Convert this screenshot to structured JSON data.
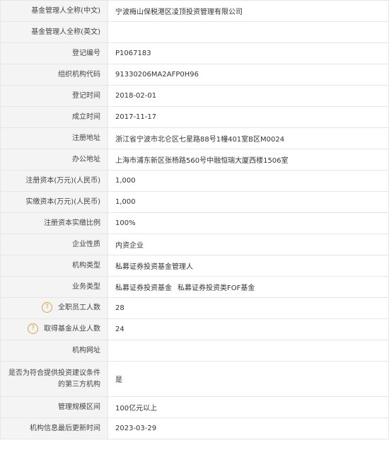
{
  "rows": [
    {
      "label": "基金管理人全称(中文)",
      "value": "宁波梅山保税港区凌顶投资管理有限公司"
    },
    {
      "label": "基金管理人全称(英文)",
      "value": ""
    },
    {
      "label": "登记编号",
      "value": "P1067183"
    },
    {
      "label": "组织机构代码",
      "value": "91330206MA2AFP0H96"
    },
    {
      "label": "登记时间",
      "value": "2018-02-01"
    },
    {
      "label": "成立时间",
      "value": "2017-11-17"
    },
    {
      "label": "注册地址",
      "value": "浙江省宁波市北仑区七星路88号1幢401室B区M0024"
    },
    {
      "label": "办公地址",
      "value": "上海市浦东新区张杨路560号中融恒瑞大厦西楼1506室"
    },
    {
      "label": "注册资本(万元)(人民币)",
      "value": "1,000"
    },
    {
      "label": "实缴资本(万元)(人民币)",
      "value": "1,000"
    },
    {
      "label": "注册资本实缴比例",
      "value": "100%"
    },
    {
      "label": "企业性质",
      "value": "内资企业"
    },
    {
      "label": "机构类型",
      "value": "私募证券投资基金管理人"
    },
    {
      "label": "业务类型",
      "value_1": "私募证券投资基金",
      "value_2": "私募证券投资类FOF基金"
    },
    {
      "label": "全职员工人数",
      "value": "28",
      "icon": "help-icon"
    },
    {
      "label": "取得基金从业人数",
      "value": "24",
      "icon": "help-icon"
    },
    {
      "label": "机构网址",
      "value": ""
    },
    {
      "label_line1": "是否为符合提供投资建议条件",
      "label_line2": "的第三方机构",
      "value": "是"
    },
    {
      "label": "管理规模区间",
      "value": "100亿元以上"
    },
    {
      "label": "机构信息最后更新时间",
      "value": "2023-03-29"
    }
  ],
  "icons": {
    "help_glyph": "?"
  },
  "colors": {
    "label_bg": "#f4f4f4",
    "border": "#e6e6e6",
    "icon": "#d9a04b"
  }
}
